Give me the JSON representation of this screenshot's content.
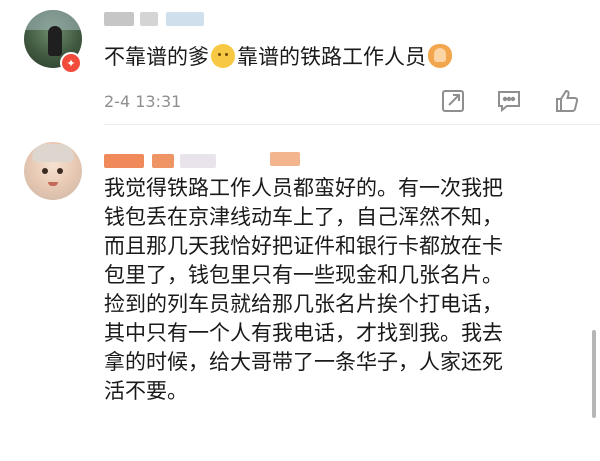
{
  "comments": [
    {
      "text_before": "不靠谱的爹",
      "text_middle": "靠谱的铁路工作人员",
      "time": "2-4 13:31",
      "emoji_1": "thinking-face-emoji",
      "emoji_2": "praying-hands-emoji"
    },
    {
      "lines": [
        "我觉得铁路工作人员都蛮好的。有一次我把",
        "钱包丢在京津线动车上了，自己浑然不知，",
        "而且那几天我恰好把证件和银行卡都放在卡",
        "包里了，钱包里只有一些现金和几张名片。",
        "捡到的列车员就给那几张名片挨个打电话，",
        "其中只有一个人有我电话，才找到我。我去",
        "拿的时候，给大哥带了一条华子，人家还死",
        "活不要。"
      ]
    }
  ],
  "icons": {
    "share": "share-icon",
    "comment": "comment-icon",
    "like": "thumbs-up-icon",
    "badge": "vip-badge-icon"
  },
  "colors": {
    "meta_gray": "#8f8f8f",
    "badge_red": "#f24b3b",
    "text": "#1a1a1a"
  }
}
